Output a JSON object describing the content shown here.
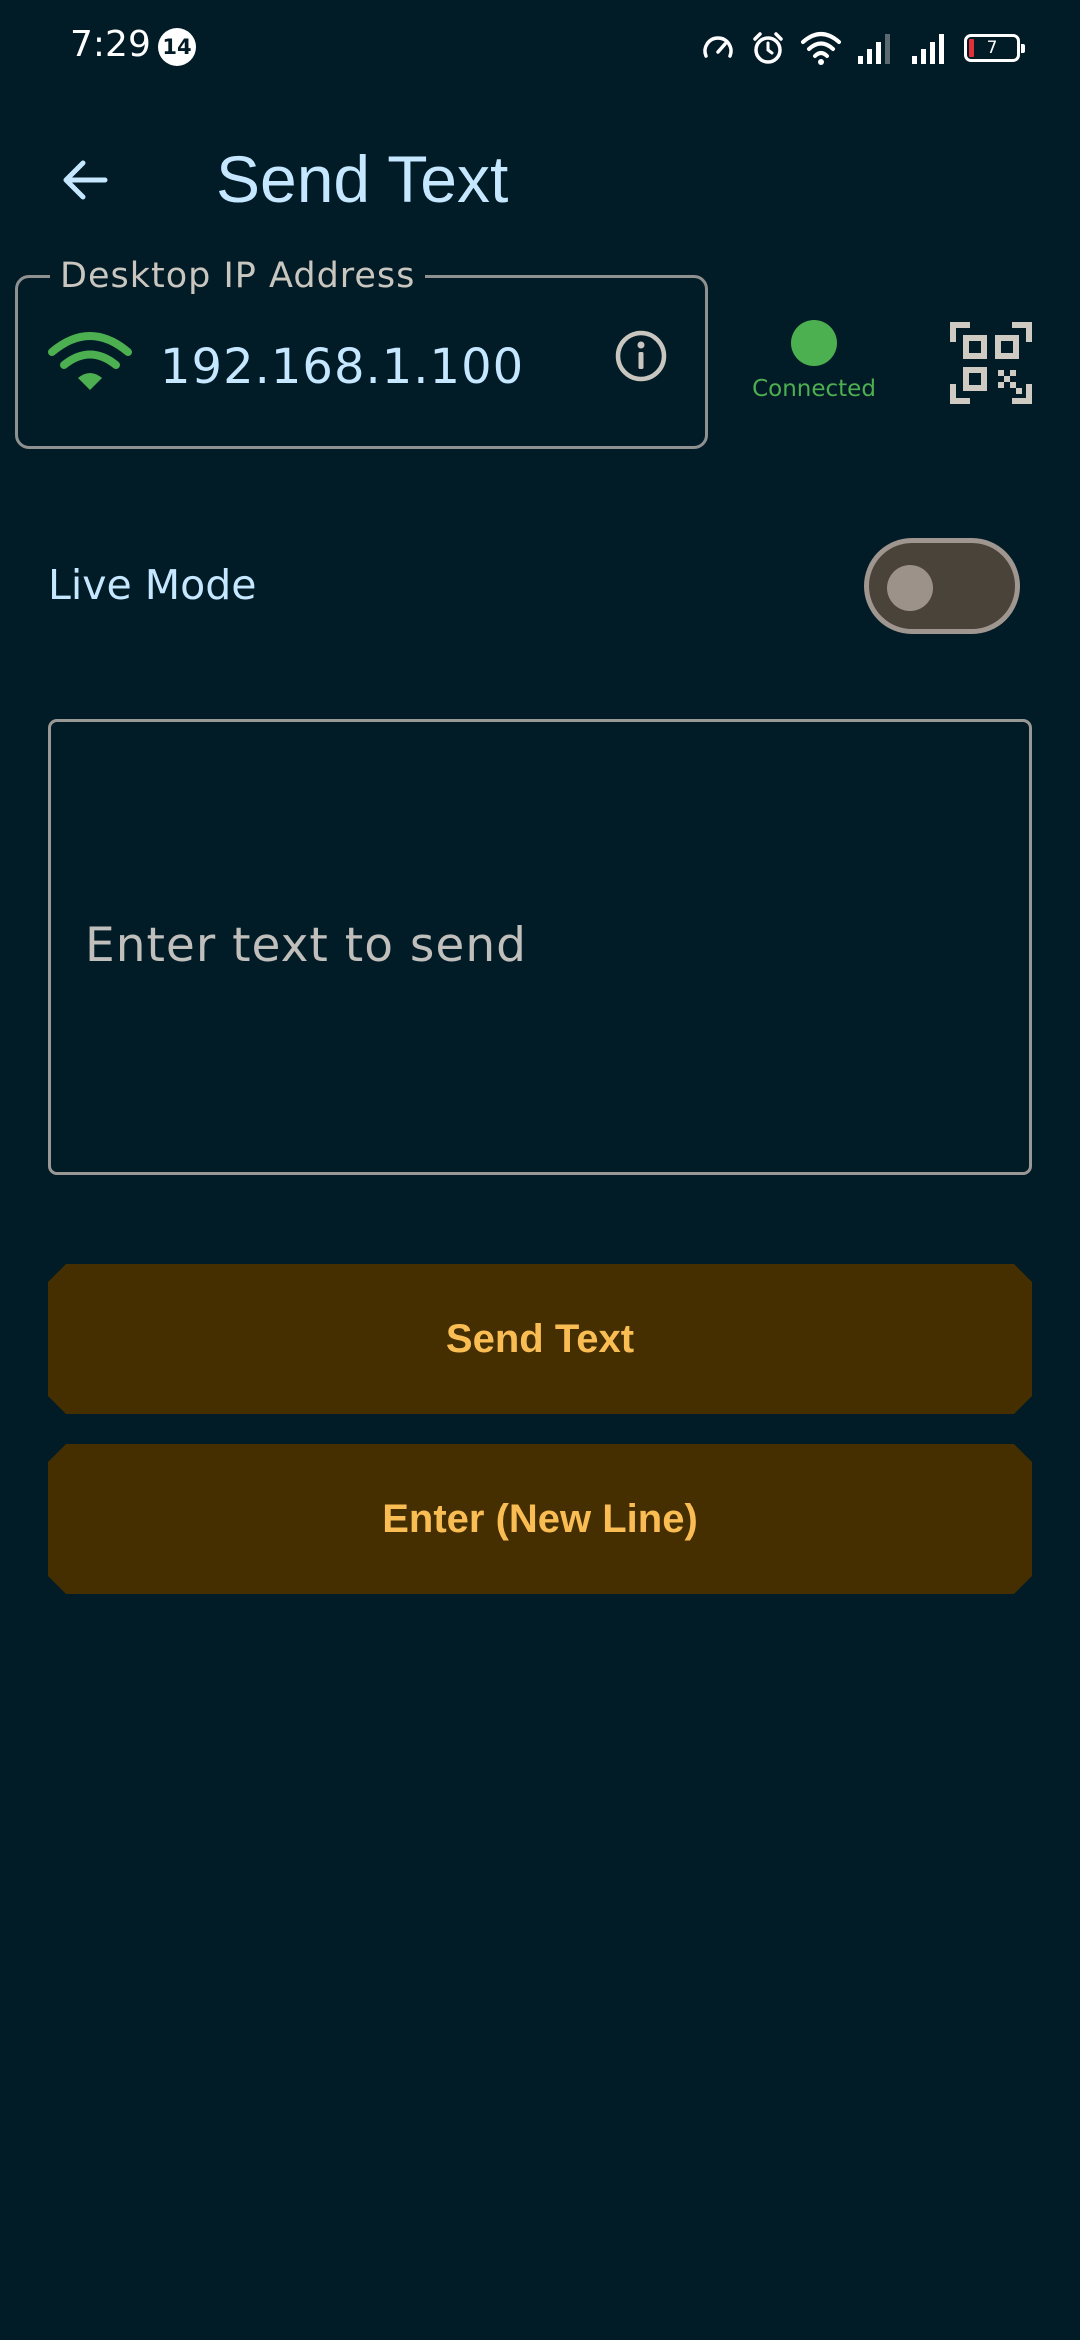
{
  "status_bar": {
    "time": "7:29",
    "notification_count": "14",
    "battery_level": "7",
    "icons": [
      "speed-icon",
      "alarm-icon",
      "wifi-icon",
      "cell-signal-icon",
      "cell-signal-icon",
      "battery-icon"
    ]
  },
  "app_bar": {
    "title": "Send Text",
    "back_icon": "arrow-left-icon"
  },
  "ip_field": {
    "label": "Desktop IP Address",
    "value": "192.168.1.100",
    "leading_icon": "wifi-icon",
    "trailing_icon": "info-icon"
  },
  "connection": {
    "status": "Connected",
    "color": "#4caf50"
  },
  "live_mode": {
    "label": "Live Mode",
    "enabled": false
  },
  "text_input": {
    "placeholder": "Enter text to send",
    "value": ""
  },
  "buttons": {
    "send_label": "Send Text",
    "enter_label": "Enter (New Line)"
  },
  "colors": {
    "background": "#021c27",
    "title_text": "#c5e7ff",
    "button_bg": "#452e00",
    "button_text": "#f9bd53",
    "accent_green": "#4caf50"
  }
}
